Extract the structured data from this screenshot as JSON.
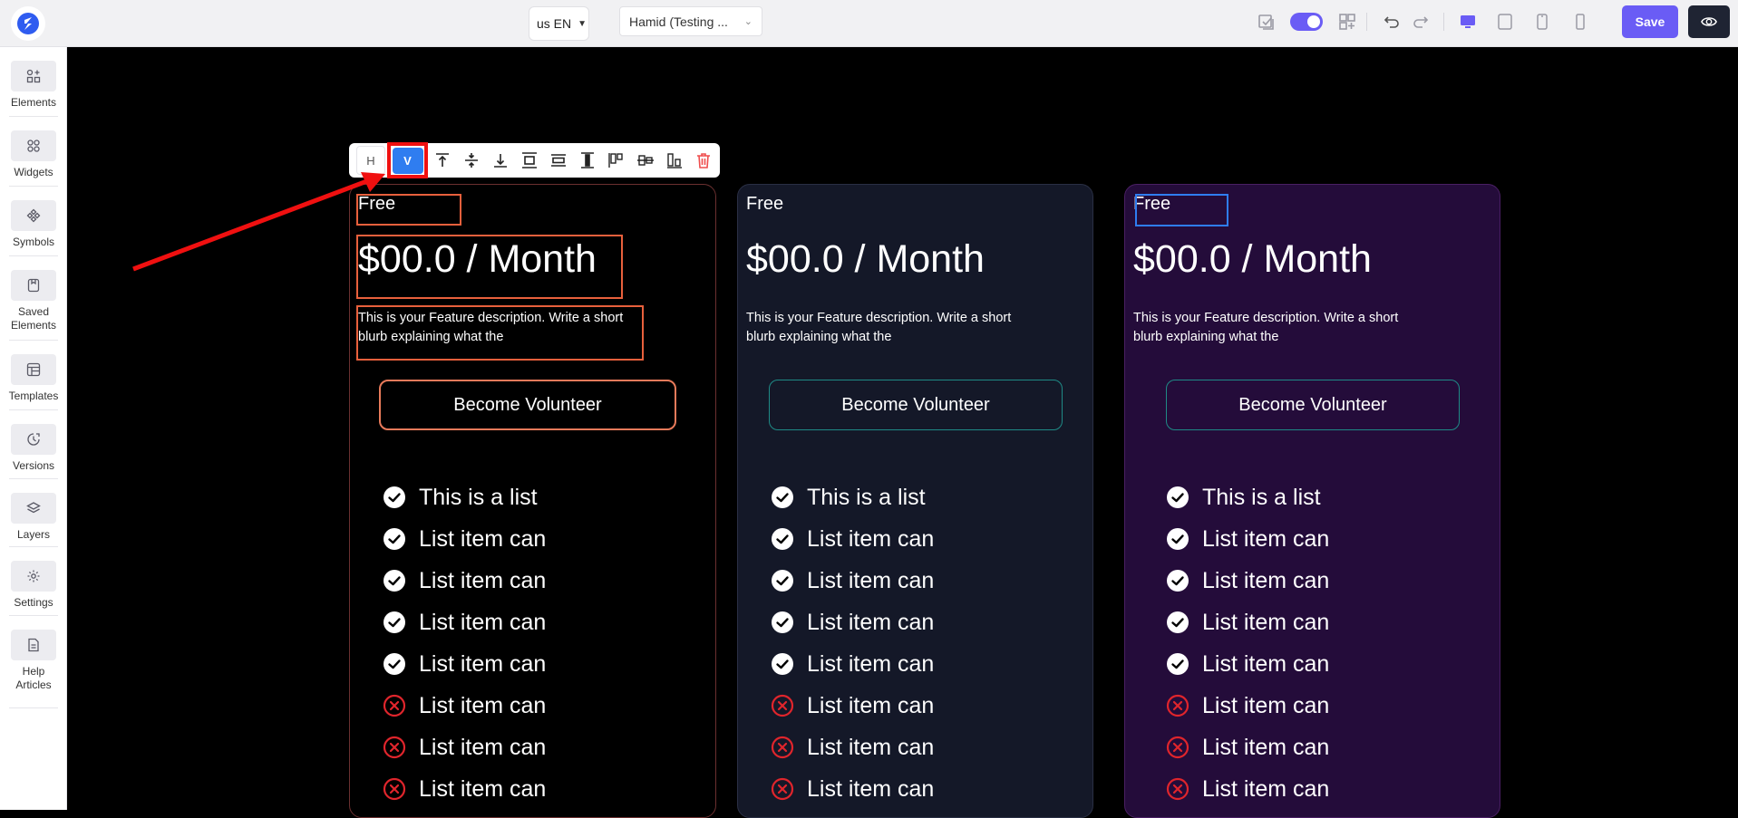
{
  "header": {
    "language": "us EN",
    "user": "Hamid (Testing ...",
    "save_label": "Save"
  },
  "sidebar": {
    "items": [
      {
        "label": "Elements",
        "icon": "add-elements-icon"
      },
      {
        "label": "Widgets",
        "icon": "widgets-icon"
      },
      {
        "label": "Symbols",
        "icon": "symbols-icon"
      },
      {
        "label": "Saved Elements",
        "icon": "saved-elements-icon"
      },
      {
        "label": "Templates",
        "icon": "templates-icon"
      },
      {
        "label": "Versions",
        "icon": "versions-icon"
      },
      {
        "label": "Layers",
        "icon": "layers-icon"
      },
      {
        "label": "Settings",
        "icon": "gear-icon"
      },
      {
        "label": "Help Articles",
        "icon": "help-articles-icon"
      }
    ]
  },
  "toolbar": {
    "h_label": "H",
    "v_label": "V"
  },
  "cards": [
    {
      "plan": "Free",
      "price": "$00.0 / Month",
      "description": "This is your Feature description. Write a short blurb explaining what the",
      "cta": "Become Volunteer",
      "items": [
        {
          "text": "This is a list",
          "status": "check"
        },
        {
          "text": "List item can",
          "status": "check"
        },
        {
          "text": "List item can",
          "status": "check"
        },
        {
          "text": "List item can",
          "status": "check"
        },
        {
          "text": "List item can",
          "status": "check"
        },
        {
          "text": "List item can",
          "status": "cross"
        },
        {
          "text": "List item can",
          "status": "cross"
        },
        {
          "text": "List item can",
          "status": "cross"
        }
      ]
    },
    {
      "plan": "Free",
      "price": "$00.0 / Month",
      "description": "This is your Feature description. Write a short blurb explaining what the",
      "cta": "Become Volunteer",
      "items": [
        {
          "text": "This is a list",
          "status": "check"
        },
        {
          "text": "List item can",
          "status": "check"
        },
        {
          "text": "List item can",
          "status": "check"
        },
        {
          "text": "List item can",
          "status": "check"
        },
        {
          "text": "List item can",
          "status": "check"
        },
        {
          "text": "List item can",
          "status": "cross"
        },
        {
          "text": "List item can",
          "status": "cross"
        },
        {
          "text": "List item can",
          "status": "cross"
        }
      ]
    },
    {
      "plan": "Free",
      "price": "$00.0 / Month",
      "description": "This is your Feature description. Write a short blurb explaining what the",
      "cta": "Become Volunteer",
      "items": [
        {
          "text": "This is a list",
          "status": "check"
        },
        {
          "text": "List item can",
          "status": "check"
        },
        {
          "text": "List item can",
          "status": "check"
        },
        {
          "text": "List item can",
          "status": "check"
        },
        {
          "text": "List item can",
          "status": "check"
        },
        {
          "text": "List item can",
          "status": "cross"
        },
        {
          "text": "List item can",
          "status": "cross"
        },
        {
          "text": "List item can",
          "status": "cross"
        }
      ]
    }
  ],
  "colors": {
    "accent": "#6a5cf5",
    "selection": "#e8603c",
    "annotation": "#f01010",
    "cross": "#e0252c"
  }
}
